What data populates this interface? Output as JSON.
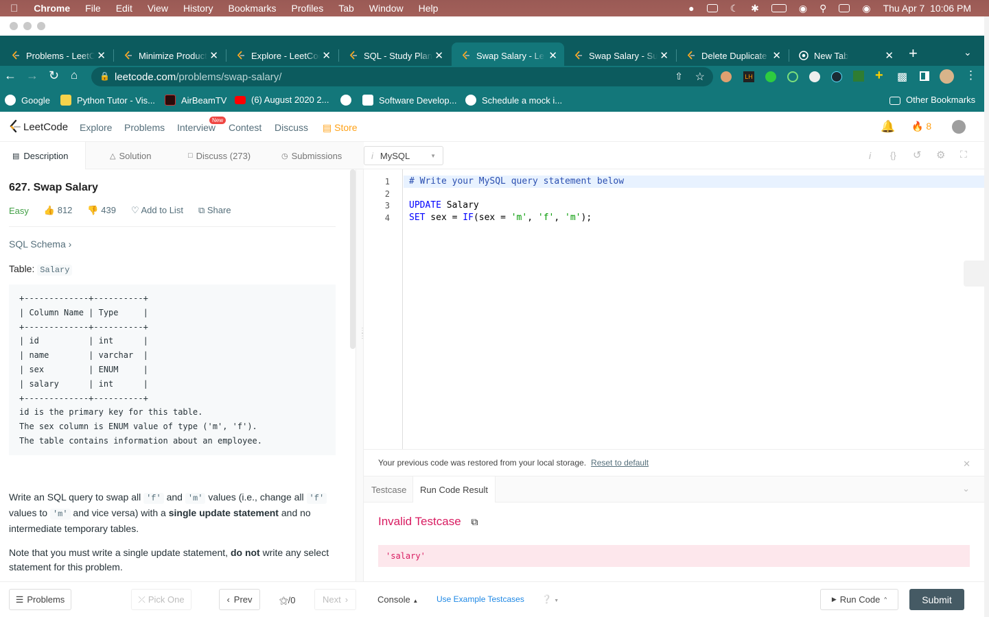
{
  "os_menu": {
    "app": "Chrome",
    "items": [
      "File",
      "Edit",
      "View",
      "History",
      "Bookmarks",
      "Profiles",
      "Tab",
      "Window",
      "Help"
    ],
    "date": "Thu Apr 7",
    "time": "10:06 PM"
  },
  "browser": {
    "tabs": [
      {
        "label": "Problems - LeetCode",
        "icon": "leetcode-icon"
      },
      {
        "label": "Minimize Product Sum",
        "icon": "leetcode-icon"
      },
      {
        "label": "Explore - LeetCode",
        "icon": "leetcode-icon"
      },
      {
        "label": "SQL - Study Plan",
        "icon": "leetcode-icon"
      },
      {
        "label": "Swap Salary - LeetCode",
        "icon": "leetcode-icon"
      },
      {
        "label": "Swap Salary - Submissions",
        "icon": "leetcode-icon"
      },
      {
        "label": "Delete Duplicate Emails",
        "icon": "leetcode-icon"
      },
      {
        "label": "New Tab",
        "icon": "chrome-icon"
      }
    ],
    "active_tab": 4,
    "url_host": "leetcode.com",
    "url_path": "/problems/swap-salary/",
    "bookmarks": [
      {
        "label": "Google",
        "icon": "google-icon"
      },
      {
        "label": "Python Tutor - Vis...",
        "icon": "python-icon"
      },
      {
        "label": "AirBeamTV",
        "icon": "airbeam-icon"
      },
      {
        "label": "(6) August 2020 2...",
        "icon": "youtube-icon"
      },
      {
        "label": "",
        "icon": "globe-icon"
      },
      {
        "label": "Software Develop...",
        "icon": "amazon-icon"
      },
      {
        "label": "Schedule a mock i...",
        "icon": "pramp-icon"
      }
    ],
    "other_bookmarks": "Other Bookmarks"
  },
  "nav": {
    "logo": "LeetCode",
    "items": [
      "Explore",
      "Problems",
      "Interview",
      "Contest",
      "Discuss"
    ],
    "new_badge": "New",
    "store": "Store",
    "streak": "8"
  },
  "left_tabs": [
    "Description",
    "Solution",
    "Discuss (273)",
    "Submissions"
  ],
  "problem": {
    "title": "627. Swap Salary",
    "difficulty": "Easy",
    "likes": "812",
    "dislikes": "439",
    "add_to_list": "Add to List",
    "share": "Share",
    "schema_link": "SQL Schema",
    "table_label": "Table:",
    "table_name": "Salary",
    "schema": "+-------------+----------+\n| Column Name | Type     |\n+-------------+----------+\n| id          | int      |\n| name        | varchar  |\n| sex         | ENUM     |\n| salary      | int      |\n+-------------+----------+\nid is the primary key for this table.\nThe sex column is ENUM value of type ('m', 'f').\nThe table contains information about an employee.",
    "para1_a": "Write an SQL query to swap all ",
    "para1_code1": "'f'",
    "para1_b": " and ",
    "para1_code2": "'m'",
    "para1_c": " values (i.e., change all ",
    "para1_code3": "'f'",
    "para1_d": " values to ",
    "para1_code4": "'m'",
    "para1_e": " and vice versa) with a ",
    "para1_bold": "single update statement",
    "para1_f": " and no intermediate temporary tables.",
    "para2_a": "Note that you must write a single update statement, ",
    "para2_bold": "do not",
    "para2_b": " write any select statement for this problem."
  },
  "editor": {
    "language": "MySQL",
    "line_numbers": [
      "1",
      "2",
      "3",
      "4"
    ],
    "line1": "# Write your MySQL query statement below",
    "line3_kw": "UPDATE",
    "line3_rest": " Salary",
    "line4_kw": "SET",
    "line4_a": " sex = ",
    "line4_fn": "IF",
    "line4_b": "(sex = ",
    "line4_s1": "'m'",
    "line4_c": ", ",
    "line4_s2": "'f'",
    "line4_d": ", ",
    "line4_s3": "'m'",
    "line4_e": ");"
  },
  "restore": {
    "message": "Your previous code was restored from your local storage.",
    "link": "Reset to default"
  },
  "result_tabs": [
    "Testcase",
    "Run Code Result"
  ],
  "result": {
    "title": "Invalid Testcase",
    "value": "'salary'"
  },
  "bottom": {
    "problems": "Problems",
    "pick_one": "Pick One",
    "prev": "Prev",
    "page": "0",
    "next": "Next",
    "console": "Console",
    "use_example": "Use Example Testcases",
    "run_code": "Run Code",
    "submit": "Submit"
  },
  "colors": {
    "tab_strip": "#0c5b5e",
    "active_tab": "#13777a",
    "store": "#ffa116",
    "easy": "#43a047",
    "error": "#d81b60",
    "submit": "#455a64"
  }
}
